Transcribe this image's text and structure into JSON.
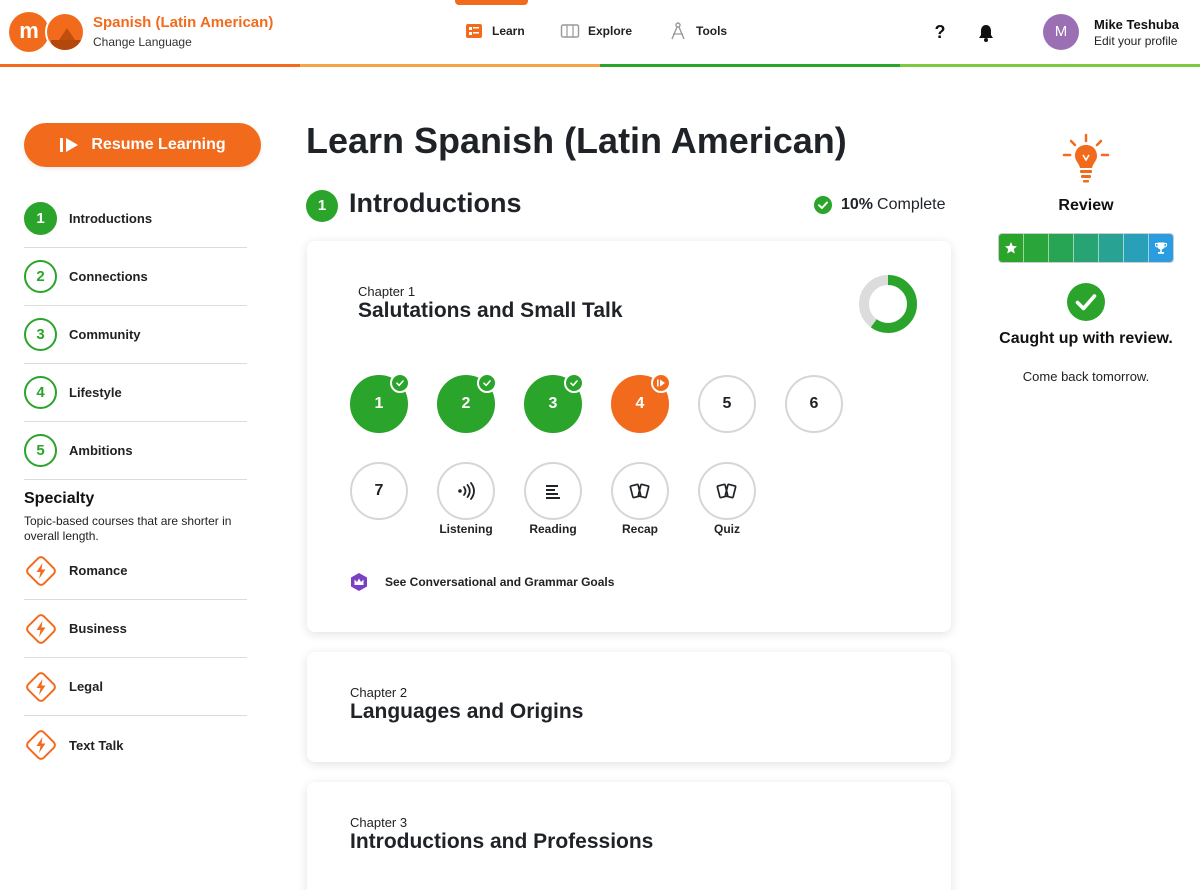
{
  "colors": {
    "brand_orange": "#f26b1d",
    "done_green": "#2aa42a",
    "review_purple": "#9b6fb3",
    "review_blue": "#2a9de0"
  },
  "header": {
    "logo_letter": "m",
    "language_title": "Spanish (Latin American)",
    "change_language": "Change Language",
    "nav": [
      {
        "label": "Learn",
        "icon": "learn-icon",
        "active": true
      },
      {
        "label": "Explore",
        "icon": "explore-icon",
        "active": false
      },
      {
        "label": "Tools",
        "icon": "tools-icon",
        "active": false
      }
    ],
    "help_label": "?",
    "avatar_initial": "M",
    "user_name": "Mike Teshuba",
    "edit_profile": "Edit your profile"
  },
  "sidebar": {
    "resume_label": "Resume Learning",
    "units": [
      {
        "number": "1",
        "label": "Introductions",
        "active": true
      },
      {
        "number": "2",
        "label": "Connections",
        "active": false
      },
      {
        "number": "3",
        "label": "Community",
        "active": false
      },
      {
        "number": "4",
        "label": "Lifestyle",
        "active": false
      },
      {
        "number": "5",
        "label": "Ambitions",
        "active": false
      }
    ],
    "specialty_title": "Specialty",
    "specialty_desc": "Topic-based courses that are shorter in overall length.",
    "specialty_items": [
      {
        "label": "Romance",
        "icon": "lightning-icon"
      },
      {
        "label": "Business",
        "icon": "lightning-icon"
      },
      {
        "label": "Legal",
        "icon": "lightning-icon"
      },
      {
        "label": "Text Talk",
        "icon": "lightning-icon"
      }
    ]
  },
  "main": {
    "page_title": "Learn Spanish (Latin American)",
    "unit_number": "1",
    "unit_title": "Introductions",
    "progress_pct": "10%",
    "progress_word": "Complete",
    "chapters": [
      {
        "label": "Chapter 1",
        "title": "Salutations and Small Talk",
        "progress_fraction": 0.6,
        "lessons": [
          {
            "label": "1",
            "status": "done"
          },
          {
            "label": "2",
            "status": "done"
          },
          {
            "label": "3",
            "status": "done"
          },
          {
            "label": "4",
            "status": "current"
          },
          {
            "label": "5",
            "status": "todo"
          },
          {
            "label": "6",
            "status": "todo"
          },
          {
            "label": "7",
            "status": "todo"
          }
        ],
        "activities": [
          {
            "label": "Listening",
            "icon": "listening-icon"
          },
          {
            "label": "Reading",
            "icon": "reading-icon"
          },
          {
            "label": "Recap",
            "icon": "cards-icon"
          },
          {
            "label": "Quiz",
            "icon": "cards-icon"
          }
        ],
        "goals_label": "See Conversational and Grammar Goals"
      },
      {
        "label": "Chapter 2",
        "title": "Languages and Origins"
      },
      {
        "label": "Chapter 3",
        "title": "Introductions and Professions"
      }
    ]
  },
  "review": {
    "title": "Review",
    "segments": 7,
    "message": "Caught up with review.",
    "sub": "Come back tomorrow."
  }
}
